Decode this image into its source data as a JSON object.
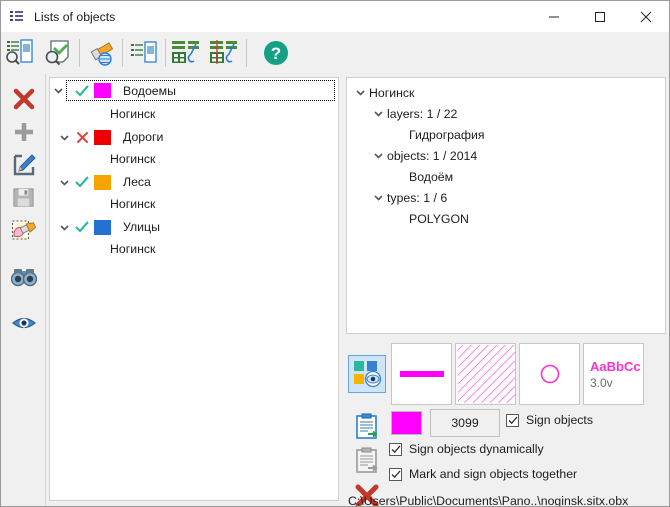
{
  "window": {
    "title": "Lists of objects",
    "icon": "list-icon",
    "minimize": "—",
    "maximize": "□",
    "close": "✕"
  },
  "toolbar": {
    "buttons": [
      {
        "name": "find-list-button",
        "icon": "list-search-icon"
      },
      {
        "name": "search-map-button",
        "icon": "map-search-icon"
      },
      {
        "name": "highlight-button",
        "icon": "flashlight-icon"
      },
      {
        "name": "list-properties-button",
        "icon": "list-properties-icon"
      },
      {
        "name": "add-selection-button",
        "icon": "table-add-icon"
      },
      {
        "name": "remove-selection-button",
        "icon": "table-remove-icon"
      },
      {
        "name": "help-button",
        "icon": "help-icon"
      }
    ]
  },
  "leftbar": {
    "buttons": [
      {
        "name": "delete-button",
        "icon": "red-cross-icon"
      },
      {
        "name": "add-button",
        "icon": "plus-icon"
      },
      {
        "name": "edit-button",
        "icon": "pencil-edit-icon"
      },
      {
        "name": "save-button",
        "icon": "floppy-save-icon"
      },
      {
        "name": "select-area-button",
        "icon": "area-select-icon"
      },
      {
        "name": "binoculars-button",
        "icon": "binoculars-icon"
      },
      {
        "name": "visibility-button",
        "icon": "eye-icon"
      }
    ]
  },
  "left_tree": {
    "rows": [
      {
        "name": "Водоемы",
        "color": "#ff00ff",
        "state": "check",
        "selected": true,
        "child": "Ногинск"
      },
      {
        "name": "Дороги",
        "color": "#ee0000",
        "state": "cross",
        "selected": false,
        "child": "Ногинск"
      },
      {
        "name": "Леса",
        "color": "#f5a400",
        "state": "check",
        "selected": false,
        "child": "Ногинск"
      },
      {
        "name": "Улицы",
        "color": "#2272d4",
        "state": "check",
        "selected": false,
        "child": "Ногинск"
      }
    ]
  },
  "right_tree": {
    "root": "Ногинск",
    "groups": [
      {
        "label": "layers: 1 / 22",
        "value": "Гидрография"
      },
      {
        "label": "objects: 1 / 2014",
        "value": "Водоём"
      },
      {
        "label": "types: 1 / 6",
        "value": "POLYGON"
      }
    ]
  },
  "style_panel": {
    "legend_button": "legend-icon",
    "previews": [
      {
        "name": "line-style-preview",
        "kind": "line"
      },
      {
        "name": "fill-style-preview",
        "kind": "hatch"
      },
      {
        "name": "marker-style-preview",
        "kind": "circle"
      },
      {
        "name": "font-style-preview",
        "kind": "text",
        "sample": "AaBbCc",
        "version": "3.0v"
      }
    ],
    "side_icons": [
      {
        "name": "copy-style-button",
        "icon": "clipboard-in-icon"
      },
      {
        "name": "paste-style-button",
        "icon": "clipboard-out-icon"
      },
      {
        "name": "clear-style-button",
        "icon": "red-cross-icon"
      }
    ],
    "color": "#ff00ff",
    "object_count": "3099",
    "checkboxes": [
      {
        "name": "sign-objects-checkbox",
        "label": "Sign objects",
        "checked": true
      },
      {
        "name": "sign-objects-dynamically-checkbox",
        "label": "Sign objects dynamically",
        "checked": true
      },
      {
        "name": "mark-and-sign-together-checkbox",
        "label": "Mark and sign objects together",
        "checked": true
      }
    ],
    "path": "C:\\Users\\Public\\Documents\\Pano..\\noginsk.sitx.obx"
  },
  "colors": {
    "accent_magenta": "#ff00ff",
    "check_green": "#2bb79b",
    "cross_red": "#e24444",
    "help_teal": "#14a085"
  }
}
